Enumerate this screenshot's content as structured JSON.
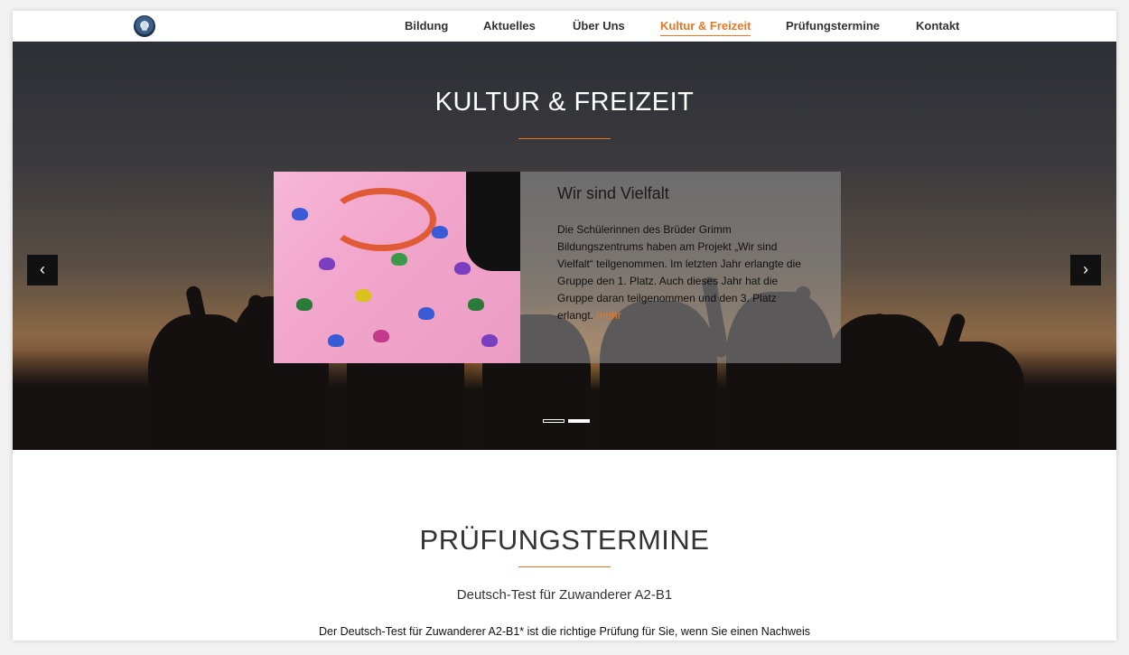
{
  "nav": {
    "items": [
      {
        "label": "Bildung",
        "active": false
      },
      {
        "label": "Aktuelles",
        "active": false
      },
      {
        "label": "Über Uns",
        "active": false
      },
      {
        "label": "Kultur & Freizeit",
        "active": true
      },
      {
        "label": "Prüfungstermine",
        "active": false
      },
      {
        "label": "Kontakt",
        "active": false
      }
    ],
    "logo_icon": "school-seal-icon"
  },
  "hero": {
    "title": "KULTUR & FREIZEIT",
    "slide": {
      "heading": "Wir sind Vielfalt",
      "body": "Die Schülerinnen des Brüder Grimm Bildungszentrums haben am Projekt „Wir sind Vielfalt“ teilgenommen. Im letzten Jahr erlangte die Gruppe den 1. Platz. Auch dieses Jahr hat die Gruppe daran teilgenommen und den 3. Platz erlangt.",
      "more_label": "mehr"
    },
    "prev_icon": "chevron-left-icon",
    "next_icon": "chevron-right-icon",
    "prev_symbol": "‹",
    "next_symbol": "›",
    "slide_count": 2,
    "active_slide": 2
  },
  "pruefung": {
    "title": "PRÜFUNGSTERMINE",
    "subtitle": "Deutsch-Test für Zuwanderer A2-B1",
    "text": "Der Deutsch-Test für Zuwanderer A2-B1* ist die richtige Prüfung für Sie, wenn Sie einen Nachweis"
  },
  "colors": {
    "accent": "#e87722",
    "nav_text": "#333333"
  }
}
